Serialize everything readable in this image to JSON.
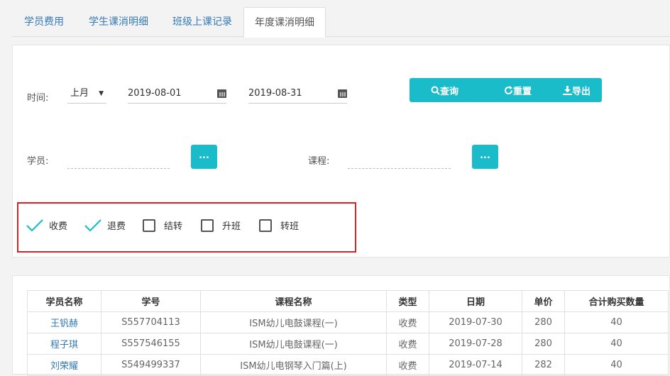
{
  "tabs": [
    {
      "label": "学员费用"
    },
    {
      "label": "学生课消明细"
    },
    {
      "label": "班级上课记录"
    },
    {
      "label": "年度课消明细"
    }
  ],
  "filters": {
    "time_label": "时间:",
    "period_value": "上月",
    "start_date": "2019-08-01",
    "end_date": "2019-08-31",
    "student_label": "学员:",
    "course_label": "课程:",
    "picker_label": "..."
  },
  "buttons": {
    "query": "查询",
    "reset": "重置",
    "export": "导出"
  },
  "checkboxes": [
    {
      "label": "收费",
      "checked": true
    },
    {
      "label": "退费",
      "checked": true
    },
    {
      "label": "结转",
      "checked": false
    },
    {
      "label": "升班",
      "checked": false
    },
    {
      "label": "转班",
      "checked": false
    }
  ],
  "table": {
    "headers": [
      "学员名称",
      "学号",
      "课程名称",
      "类型",
      "日期",
      "单价",
      "合计购买数量"
    ],
    "rows": [
      [
        "王钒赫",
        "S557704113",
        "ISM幼儿电鼓课程(一)",
        "收费",
        "2019-07-30",
        "280",
        "40"
      ],
      [
        "程子琪",
        "S557546155",
        "ISM幼儿电鼓课程(一)",
        "收费",
        "2019-07-28",
        "280",
        "40"
      ],
      [
        "刘荣耀",
        "S549499337",
        "ISM幼儿电钢琴入门篇(上)",
        "收费",
        "2019-07-14",
        "282",
        "40"
      ]
    ]
  },
  "colors": {
    "accent": "#1abcca",
    "link": "#337ab7",
    "highlight_border": "#e02020"
  }
}
